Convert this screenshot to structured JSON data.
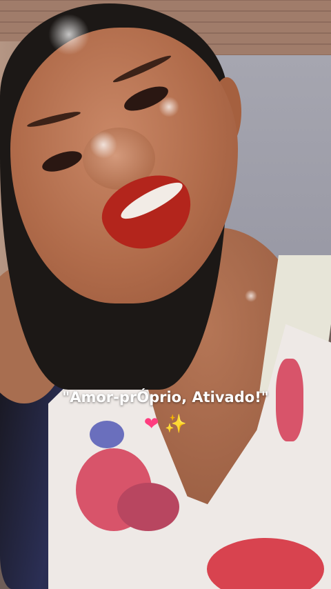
{
  "caption": {
    "text": "\"Amor-prÓprio, Ativado!\"",
    "emoji": [
      {
        "name": "heart-icon",
        "glyph": "❤"
      },
      {
        "name": "sparkles-icon",
        "glyph": "✨"
      }
    ]
  },
  "colors": {
    "lipstick": "#b3251c",
    "heart": "#ff3d7f",
    "sparkles": "#ffd23a"
  }
}
